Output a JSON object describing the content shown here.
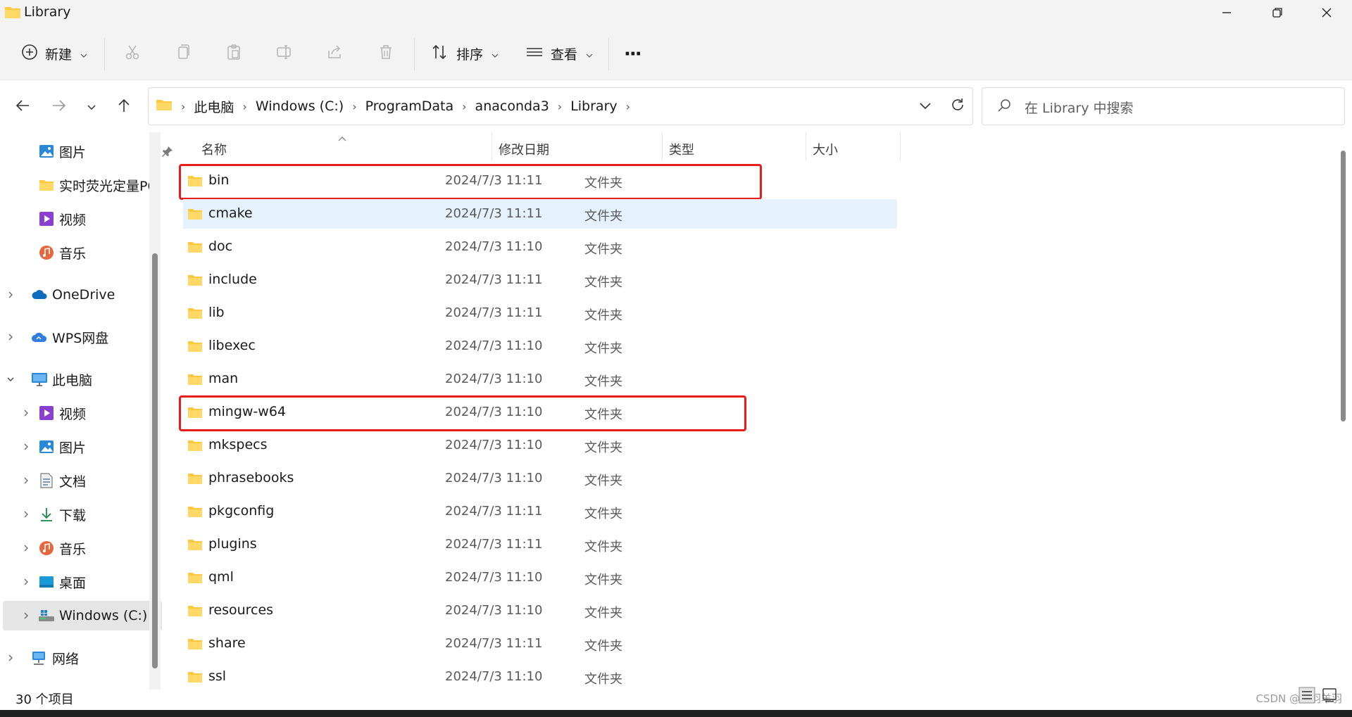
{
  "window": {
    "title": "Library",
    "folder_color": "#ffc83d"
  },
  "toolbar": {
    "new_label": "新建",
    "sort_label": "排序",
    "view_label": "查看",
    "more_label": "···"
  },
  "nav": {
    "breadcrumbs": [
      "此电脑",
      "Windows (C:)",
      "ProgramData",
      "anaconda3",
      "Library"
    ],
    "search_placeholder": "在 Library 中搜索"
  },
  "sidebar": {
    "items": [
      {
        "label": "图片",
        "icon": "pictures-icon",
        "pinned": true
      },
      {
        "label": "实时荧光定量PC",
        "icon": "folder-icon"
      },
      {
        "label": "视频",
        "icon": "videos-icon"
      },
      {
        "label": "音乐",
        "icon": "music-icon"
      },
      {
        "label": "OneDrive",
        "icon": "onedrive-icon"
      },
      {
        "label": "WPS网盘",
        "icon": "wps-cloud-icon"
      },
      {
        "label": "此电脑",
        "icon": "this-pc-icon"
      },
      {
        "label": "视频",
        "icon": "videos-icon"
      },
      {
        "label": "图片",
        "icon": "pictures-icon"
      },
      {
        "label": "文档",
        "icon": "documents-icon"
      },
      {
        "label": "下载",
        "icon": "downloads-icon"
      },
      {
        "label": "音乐",
        "icon": "music-icon"
      },
      {
        "label": "桌面",
        "icon": "desktop-icon"
      },
      {
        "label": "Windows (C:)",
        "icon": "drive-icon",
        "selected": true
      },
      {
        "label": "网络",
        "icon": "network-icon"
      }
    ]
  },
  "columns": {
    "name": "名称",
    "date": "修改日期",
    "type": "类型",
    "size": "大小"
  },
  "files": [
    {
      "name": "bin",
      "date": "2024/7/3 11:11",
      "type": "文件夹",
      "highlighted": true
    },
    {
      "name": "cmake",
      "date": "2024/7/3 11:11",
      "type": "文件夹",
      "hovered": true
    },
    {
      "name": "doc",
      "date": "2024/7/3 11:10",
      "type": "文件夹"
    },
    {
      "name": "include",
      "date": "2024/7/3 11:11",
      "type": "文件夹"
    },
    {
      "name": "lib",
      "date": "2024/7/3 11:11",
      "type": "文件夹"
    },
    {
      "name": "libexec",
      "date": "2024/7/3 11:10",
      "type": "文件夹"
    },
    {
      "name": "man",
      "date": "2024/7/3 11:10",
      "type": "文件夹"
    },
    {
      "name": "mingw-w64",
      "date": "2024/7/3 11:10",
      "type": "文件夹",
      "highlighted": true
    },
    {
      "name": "mkspecs",
      "date": "2024/7/3 11:10",
      "type": "文件夹"
    },
    {
      "name": "phrasebooks",
      "date": "2024/7/3 11:10",
      "type": "文件夹"
    },
    {
      "name": "pkgconfig",
      "date": "2024/7/3 11:11",
      "type": "文件夹"
    },
    {
      "name": "plugins",
      "date": "2024/7/3 11:11",
      "type": "文件夹"
    },
    {
      "name": "qml",
      "date": "2024/7/3 11:10",
      "type": "文件夹"
    },
    {
      "name": "resources",
      "date": "2024/7/3 11:10",
      "type": "文件夹"
    },
    {
      "name": "share",
      "date": "2024/7/3 11:11",
      "type": "文件夹"
    },
    {
      "name": "ssl",
      "date": "2024/7/3 11:10",
      "type": "文件夹"
    }
  ],
  "status": {
    "item_count": "30 个项目",
    "watermark": "CSDN @羊羽羊羽"
  },
  "colors": {
    "highlight_box": "#e81c1c",
    "hover_row": "#e5f1fb",
    "accent": "#0067c0"
  }
}
